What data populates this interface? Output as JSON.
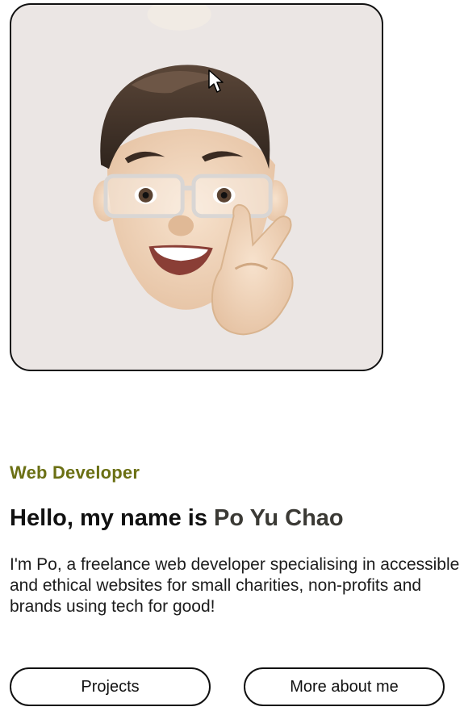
{
  "hero": {
    "avatar_alt": "Memoji of Po Yu Chao with glasses giving a peace sign",
    "role": "Web Developer",
    "greeting_prefix": "Hello, my name is ",
    "name": "Po Yu Chao",
    "intro": "I'm Po, a freelance web developer specialising in accessible and ethical websites for small charities, non-profits and brands using tech for good!"
  },
  "buttons": {
    "projects": "Projects",
    "about": "More about me"
  },
  "colors": {
    "role": "#6b7014",
    "border": "#111111",
    "avatar_bg": "#ebe6e4"
  }
}
